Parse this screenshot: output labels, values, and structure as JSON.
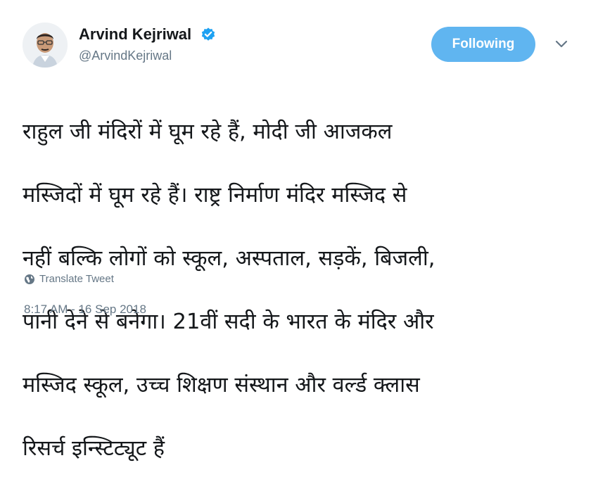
{
  "author": {
    "display_name": "Arvind Kejriwal",
    "handle": "@ArvindKejriwal",
    "verified": true,
    "avatar_icon": "user-avatar"
  },
  "follow_button": {
    "label": "Following",
    "color": "#60b5f0"
  },
  "menu_icon": "chevron-down-icon",
  "tweet": {
    "lines": [
      "राहुल जी मंदिरों में घूम रहे हैं, मोदी जी आजकल",
      "मस्जिदों में घूम रहे हैं। राष्ट्र निर्माण मंदिर मस्जिद से",
      "नहीं बल्कि लोगों को स्कूल, अस्पताल, सड़कें, बिजली,",
      "पानी देने से बनेगा। 21वीं सदी के भारत के मंदिर और",
      "मस्जिद स्कूल, उच्च शिक्षण संस्थान और वर्ल्ड क्लास",
      "रिसर्च इन्स्टिट्यूट हैं"
    ]
  },
  "translate": {
    "label": "Translate Tweet",
    "icon": "globe-icon"
  },
  "timestamp": "8:17 AM - 16 Sep 2018",
  "colors": {
    "accent": "#1da1f2",
    "muted": "#657786",
    "text": "#14171a"
  }
}
